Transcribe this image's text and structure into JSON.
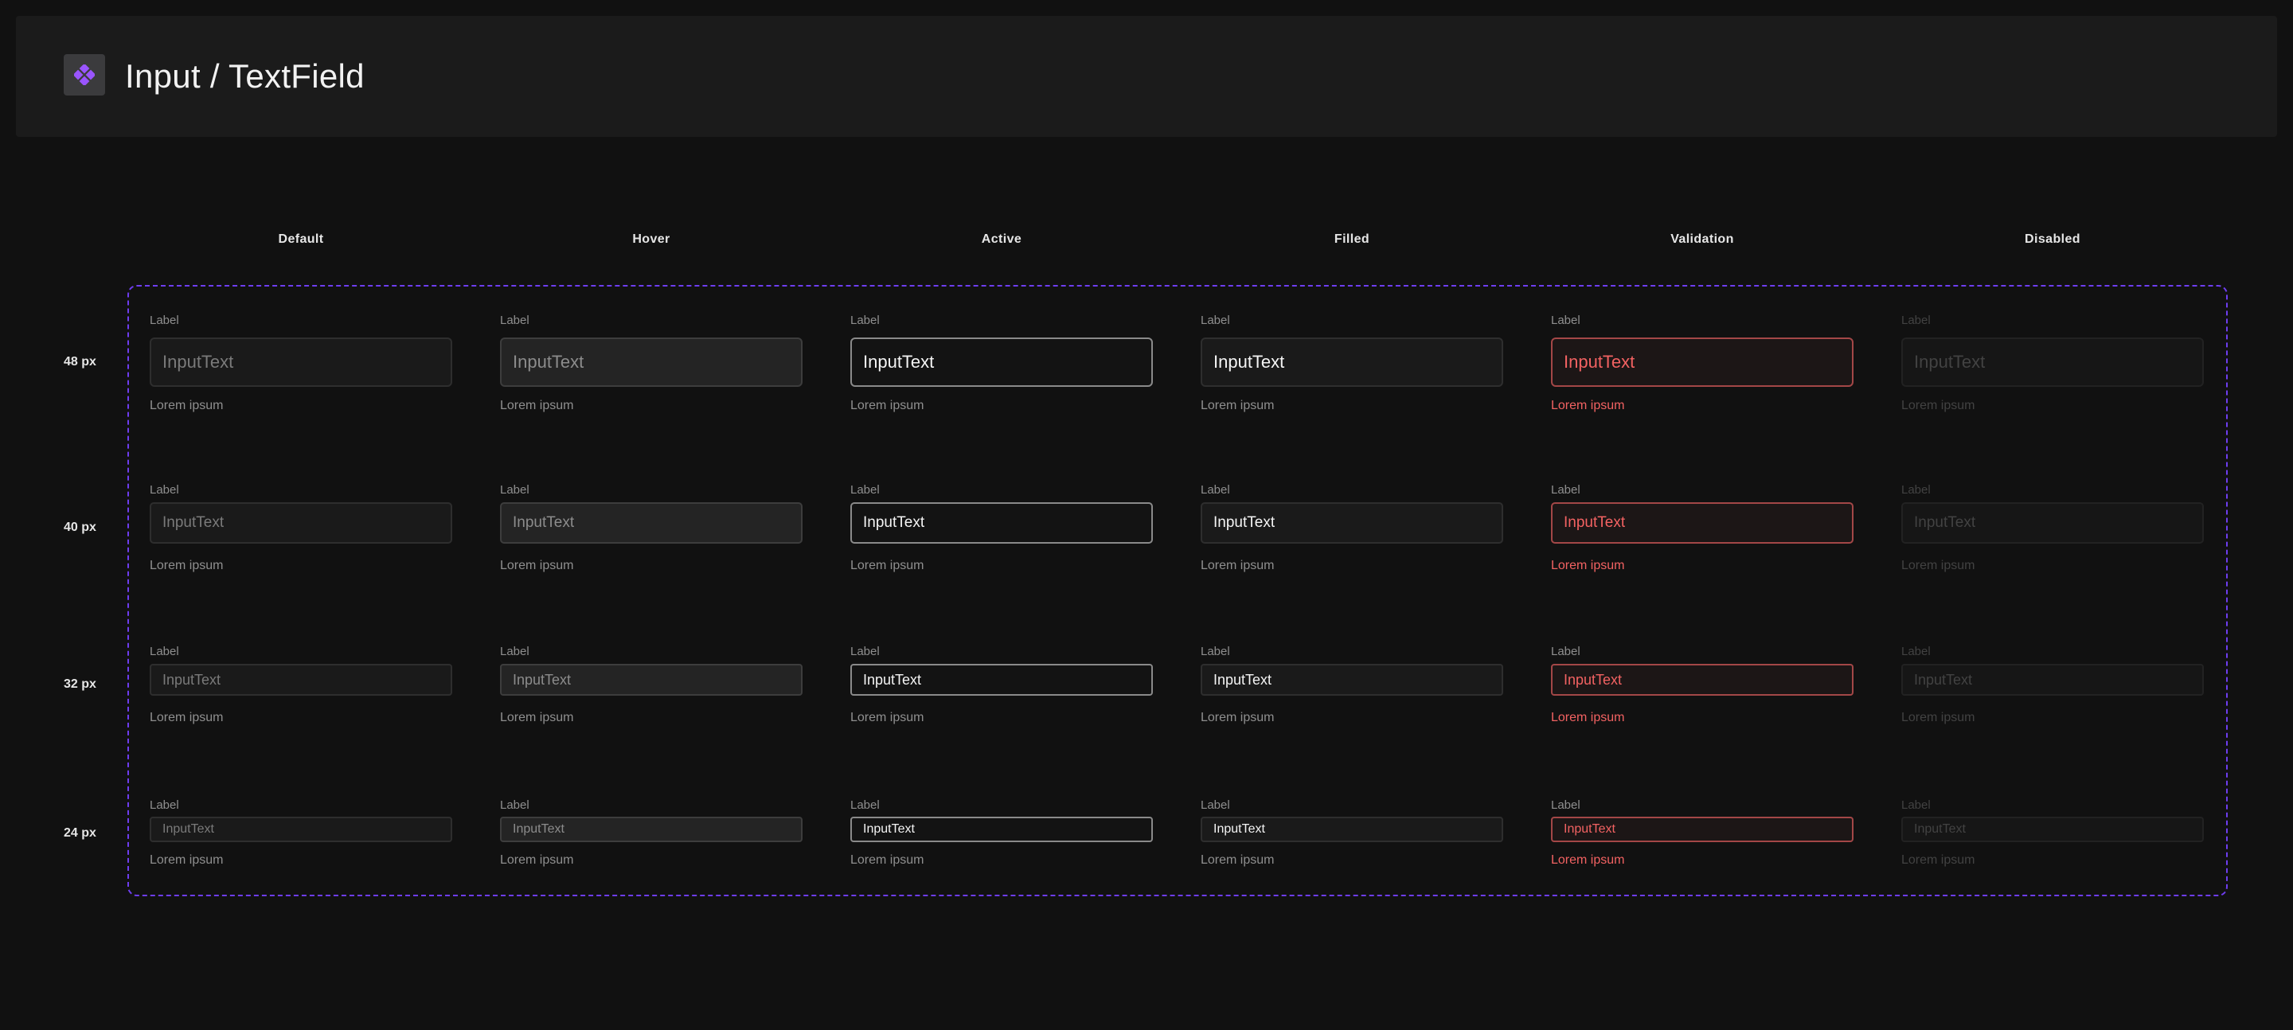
{
  "title": "Input / TextField",
  "logo_icon": "component-icon",
  "accent_color": "#6e3df0",
  "columns": [
    "Default",
    "Hover",
    "Active",
    "Filled",
    "Validation",
    "Disabled"
  ],
  "rows": [
    "48 px",
    "40 px",
    "32 px",
    "24 px"
  ],
  "field": {
    "label": "Label",
    "value": "InputText",
    "helper": "Lorem ipsum"
  }
}
